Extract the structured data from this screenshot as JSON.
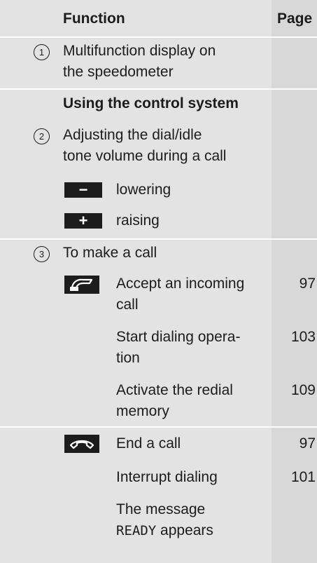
{
  "header": {
    "function_label": "Function",
    "page_label": "Page"
  },
  "rows": {
    "r1": {
      "number": "1",
      "line1": "Multifunction display on",
      "line2": "the speedometer"
    },
    "section_title": "Using the control system",
    "r2": {
      "number": "2",
      "line1": "Adjusting the dial/idle",
      "line2": "tone volume during a call"
    },
    "minus": {
      "key": "−",
      "label": "lowering"
    },
    "plus": {
      "key": "+",
      "label": "raising"
    },
    "r3": {
      "number": "3",
      "title": "To make a call"
    },
    "accept": {
      "line1": "Accept an incoming",
      "line2": "call",
      "page": "97"
    },
    "start": {
      "line1": "Start dialing opera-",
      "line2": "tion",
      "page": "103"
    },
    "redial": {
      "line1": "Activate the redial",
      "line2": "memory",
      "page": "109"
    },
    "end": {
      "label": "End a call",
      "page": "97"
    },
    "interrupt": {
      "label": "Interrupt dialing",
      "page": "101"
    },
    "message": {
      "line1": "The message",
      "ready": "READY",
      "line2_rest": " appears"
    }
  },
  "icons": {
    "accept_icon": "phone-pickup-icon",
    "end_icon": "phone-hangup-icon"
  },
  "colors": {
    "band": "#e3e3e3",
    "page_column": "#d8d8d8",
    "text": "#1c1c1c"
  }
}
